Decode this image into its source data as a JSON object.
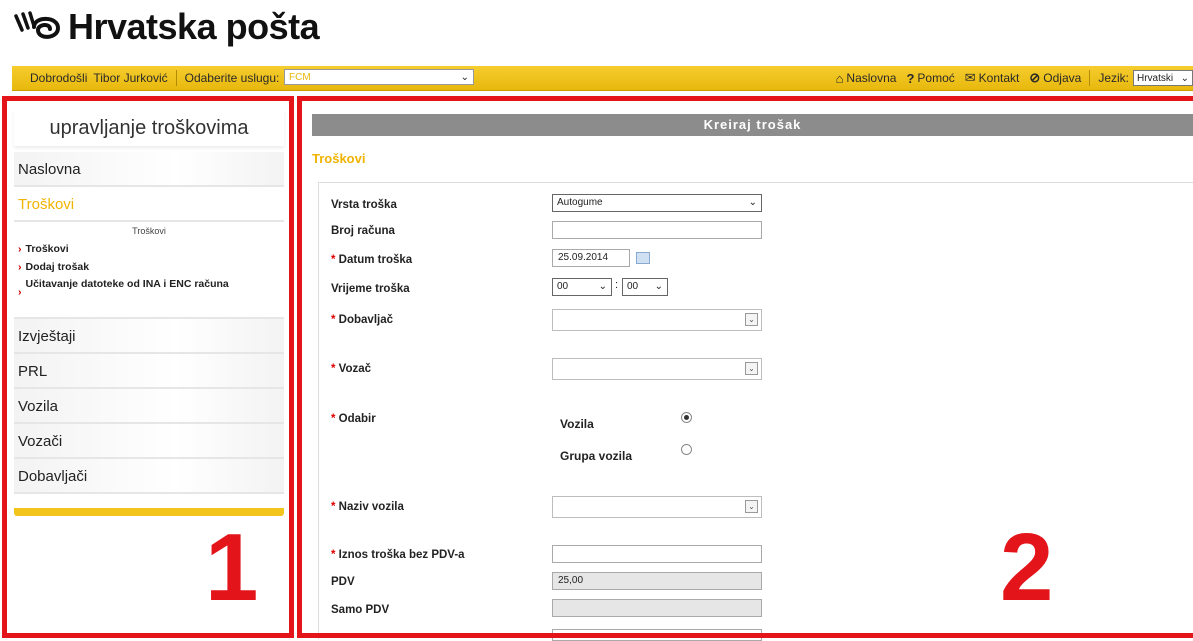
{
  "logo": {
    "text": "Hrvatska pošta"
  },
  "topbar": {
    "welcome": "Dobrodošli",
    "user": "Tibor Jurković",
    "service_label": "Odaberite uslugu:",
    "service_value": "FCM",
    "nav": [
      {
        "label": "Naslovna",
        "icon": "home-icon"
      },
      {
        "label": "Pomoć",
        "icon": "help-icon"
      },
      {
        "label": "Kontakt",
        "icon": "mail-icon"
      },
      {
        "label": "Odjava",
        "icon": "logout-icon"
      }
    ],
    "language_label": "Jezik:",
    "language_value": "Hrvatski"
  },
  "sidebar": {
    "title": "upravljanje troškovima",
    "items": [
      "Naslovna",
      "Troškovi",
      "Izvještaji",
      "PRL",
      "Vozila",
      "Vozači",
      "Dobavljači"
    ],
    "submenu_heading": "Troškovi",
    "submenu": [
      "Troškovi",
      "Dodaj trošak",
      "Učitavanje datoteke od INA i ENC računa"
    ]
  },
  "annotations": {
    "left": "1",
    "right": "2"
  },
  "main": {
    "header": "Kreiraj trošak",
    "section_title": "Troškovi",
    "fields": {
      "vrsta": {
        "label": "Vrsta troška",
        "value": "Autogume"
      },
      "broj": {
        "label": "Broj računa",
        "value": ""
      },
      "datum": {
        "label": "Datum troška",
        "value": "25.09.2014"
      },
      "vrijeme": {
        "label": "Vrijeme troška",
        "hours": "00",
        "minutes": "00"
      },
      "dobavljac": {
        "label": "Dobavljač"
      },
      "vozac": {
        "label": "Vozač"
      },
      "odabir": {
        "label": "Odabir",
        "options": [
          "Vozila",
          "Grupa vozila"
        ],
        "selected": "Vozila"
      },
      "naziv": {
        "label": "Naziv vozila"
      },
      "iznos": {
        "label": "Iznos troška bez PDV-a",
        "value": ""
      },
      "pdv": {
        "label": "PDV",
        "value": "25,00"
      },
      "samo_pdv": {
        "label": "Samo PDV",
        "value": ""
      }
    }
  },
  "colors": {
    "brand_yellow": "#f3c41c",
    "annotation_red": "#e3151b",
    "header_gray": "#8c8c8c"
  }
}
